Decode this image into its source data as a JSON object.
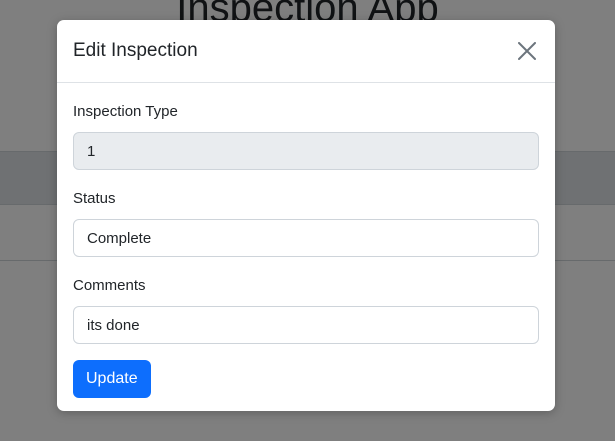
{
  "background": {
    "app_title": "Inspection App"
  },
  "modal": {
    "title": "Edit Inspection",
    "close_icon": "close-icon",
    "fields": {
      "inspection_type": {
        "label": "Inspection Type",
        "value": "1",
        "disabled": true
      },
      "status": {
        "label": "Status",
        "value": "Complete"
      },
      "comments": {
        "label": "Comments",
        "value": "its done"
      }
    },
    "submit_label": "Update"
  },
  "colors": {
    "primary": "#0d6efd",
    "overlay": "rgba(0,0,0,0.5)",
    "disabled_input_bg": "#e9ecef"
  }
}
